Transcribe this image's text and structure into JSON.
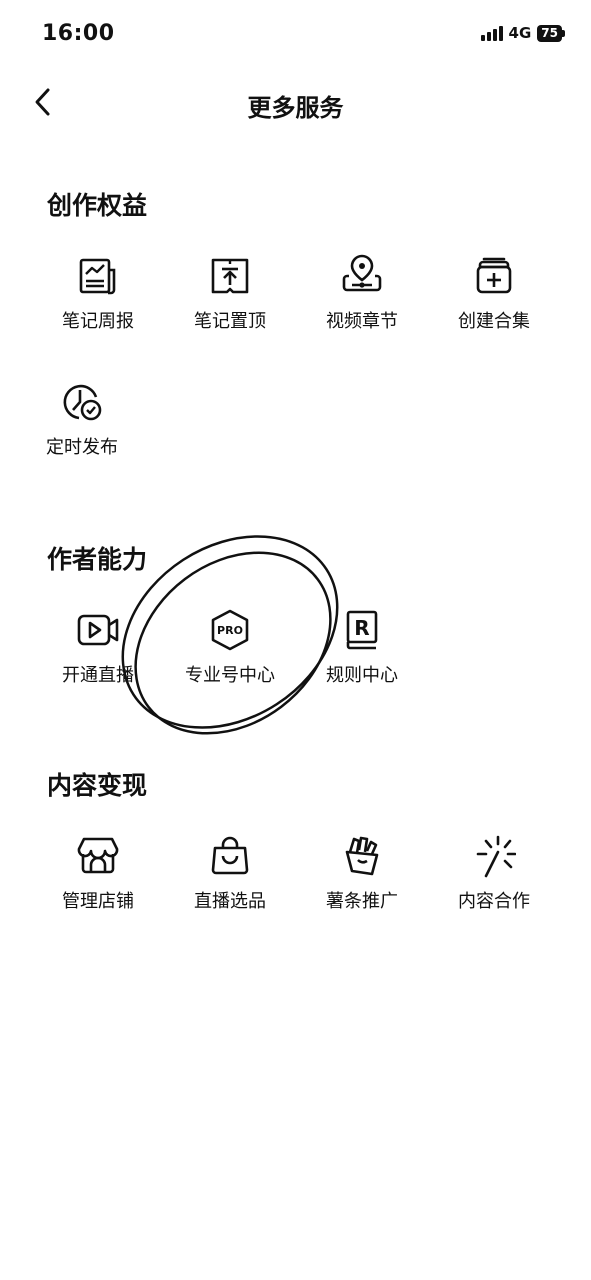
{
  "status_bar": {
    "time": "16:00",
    "network": "4G",
    "battery": "75"
  },
  "nav": {
    "title": "更多服务",
    "back_icon": "chevron-left-icon"
  },
  "sections": [
    {
      "title": "创作权益",
      "items": [
        {
          "label": "笔记周报",
          "icon": "report-icon"
        },
        {
          "label": "笔记置顶",
          "icon": "pin-top-icon"
        },
        {
          "label": "视频章节",
          "icon": "video-chapter-icon"
        },
        {
          "label": "创建合集",
          "icon": "add-collection-icon"
        },
        {
          "label": "定时发布",
          "icon": "clock-check-icon"
        }
      ]
    },
    {
      "title": "作者能力",
      "items": [
        {
          "label": "开通直播",
          "icon": "live-camera-icon"
        },
        {
          "label": "专业号中心",
          "icon": "pro-badge-icon",
          "badge": "PRO"
        },
        {
          "label": "规则中心",
          "icon": "rules-book-icon",
          "badge": "R"
        }
      ]
    },
    {
      "title": "内容变现",
      "items": [
        {
          "label": "管理店铺",
          "icon": "store-icon"
        },
        {
          "label": "直播选品",
          "icon": "shopping-bag-icon"
        },
        {
          "label": "薯条推广",
          "icon": "fries-icon"
        },
        {
          "label": "内容合作",
          "icon": "sparkle-icon"
        }
      ]
    }
  ]
}
